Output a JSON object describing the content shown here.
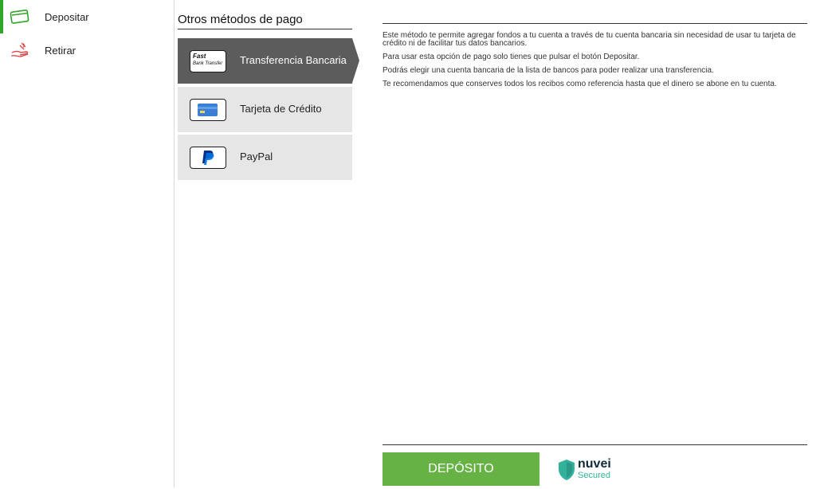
{
  "sidebar": {
    "items": [
      {
        "label": "Depositar",
        "icon": "card-icon",
        "active": true
      },
      {
        "label": "Retirar",
        "icon": "hand-money-icon",
        "active": false
      }
    ]
  },
  "methods": {
    "title": "Otros métodos de pago",
    "items": [
      {
        "label": "Transferencia Bancaria",
        "icon": "fast-bank-transfer-logo",
        "logo_text": "Fast",
        "logo_subtext": "Bank Transfer",
        "active": true
      },
      {
        "label": "Tarjeta de Crédito",
        "icon": "credit-card-icon",
        "active": false
      },
      {
        "label": "PayPal",
        "icon": "paypal-icon",
        "active": false
      }
    ]
  },
  "content": {
    "paragraphs": [
      "Este método te permite agregar fondos a tu cuenta a través de tu cuenta bancaria sin necesidad de usar tu tarjeta de crédito ni de facilitar tus datos bancarios.",
      "Para usar esta opción de pago solo tienes que pulsar el botón Depositar.",
      "Podrás elegir una cuenta bancaria de la lista de bancos para poder realizar una transferencia.",
      "Te recomendamos que conserves todos los recibos como referencia hasta que el dinero se abone en tu cuenta."
    ],
    "deposit_button": "DEPÓSITO",
    "security_brand": "nuvei",
    "security_label": "Secured"
  },
  "colors": {
    "accent_green": "#2fa52a",
    "button_green": "#66b245",
    "active_method_bg": "#5c5c5c",
    "method_bg": "#e6e6e6"
  }
}
